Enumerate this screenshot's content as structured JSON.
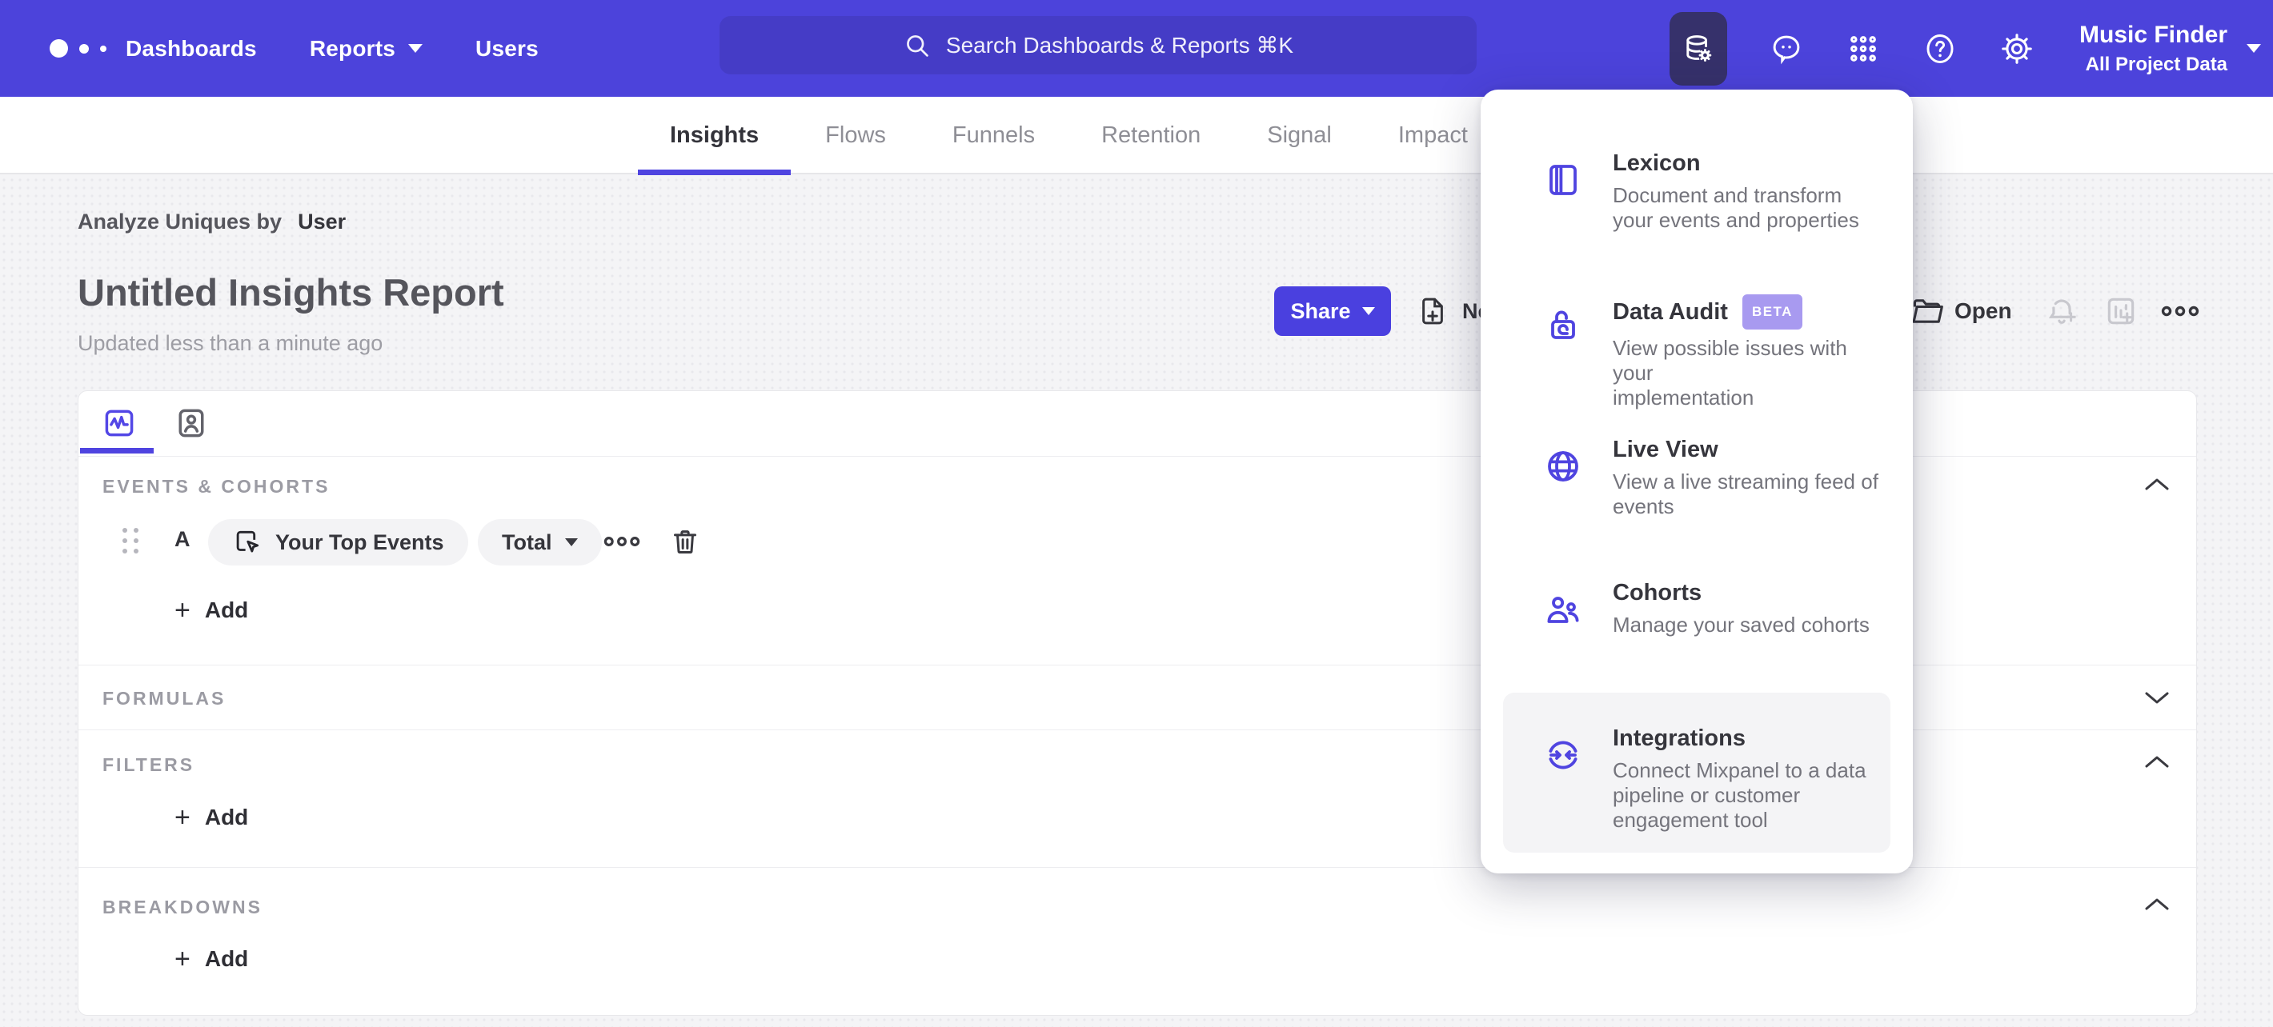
{
  "header": {
    "nav": {
      "dashboards": "Dashboards",
      "reports": "Reports",
      "users": "Users"
    },
    "search": {
      "placeholder": "Search Dashboards & Reports ⌘K"
    },
    "project": {
      "name": "Music Finder",
      "scope": "All Project Data"
    }
  },
  "tabs": {
    "items": [
      {
        "label": "Insights"
      },
      {
        "label": "Flows"
      },
      {
        "label": "Funnels"
      },
      {
        "label": "Retention"
      },
      {
        "label": "Signal"
      },
      {
        "label": "Impact"
      }
    ],
    "active": "Insights"
  },
  "report": {
    "breadcrumb_prefix": "Analyze Uniques by",
    "breadcrumb_value": "User",
    "title": "Untitled Insights Report",
    "updated": "Updated less than a minute ago",
    "actions": {
      "share": "Share",
      "new": "New",
      "open": "Open"
    }
  },
  "builder": {
    "events_label": "EVENTS & COHORTS",
    "formulas_label": "FORMULAS",
    "filters_label": "FILTERS",
    "breakdowns_label": "BREAKDOWNS",
    "row": {
      "series": "A",
      "event": "Your Top Events",
      "aggregation": "Total"
    },
    "add_label": "Add"
  },
  "menu": {
    "items": [
      {
        "title": "Lexicon",
        "desc_lines": [
          "Document and transform",
          "your events and properties"
        ]
      },
      {
        "title": "Data Audit",
        "badge": "BETA",
        "desc_lines": [
          "View possible issues with your",
          "implementation"
        ]
      },
      {
        "title": "Live View",
        "desc_lines": [
          "View a live streaming feed of",
          "events"
        ]
      },
      {
        "title": "Cohorts",
        "desc_lines": [
          "Manage your saved cohorts"
        ]
      },
      {
        "title": "Integrations",
        "highlighted": true,
        "desc_lines": [
          "Connect Mixpanel to a data",
          "pipeline or customer",
          "engagement tool"
        ]
      }
    ]
  },
  "colors": {
    "accent": "#4f44e0",
    "header_bg": "#4c43db",
    "search_bg": "#453cc6",
    "active_tile_bg": "#36316b",
    "badge_bg": "#a89af0",
    "page_bg": "#f4f4f6",
    "muted_label": "#9b9ba3",
    "dark_text": "#35353b"
  }
}
